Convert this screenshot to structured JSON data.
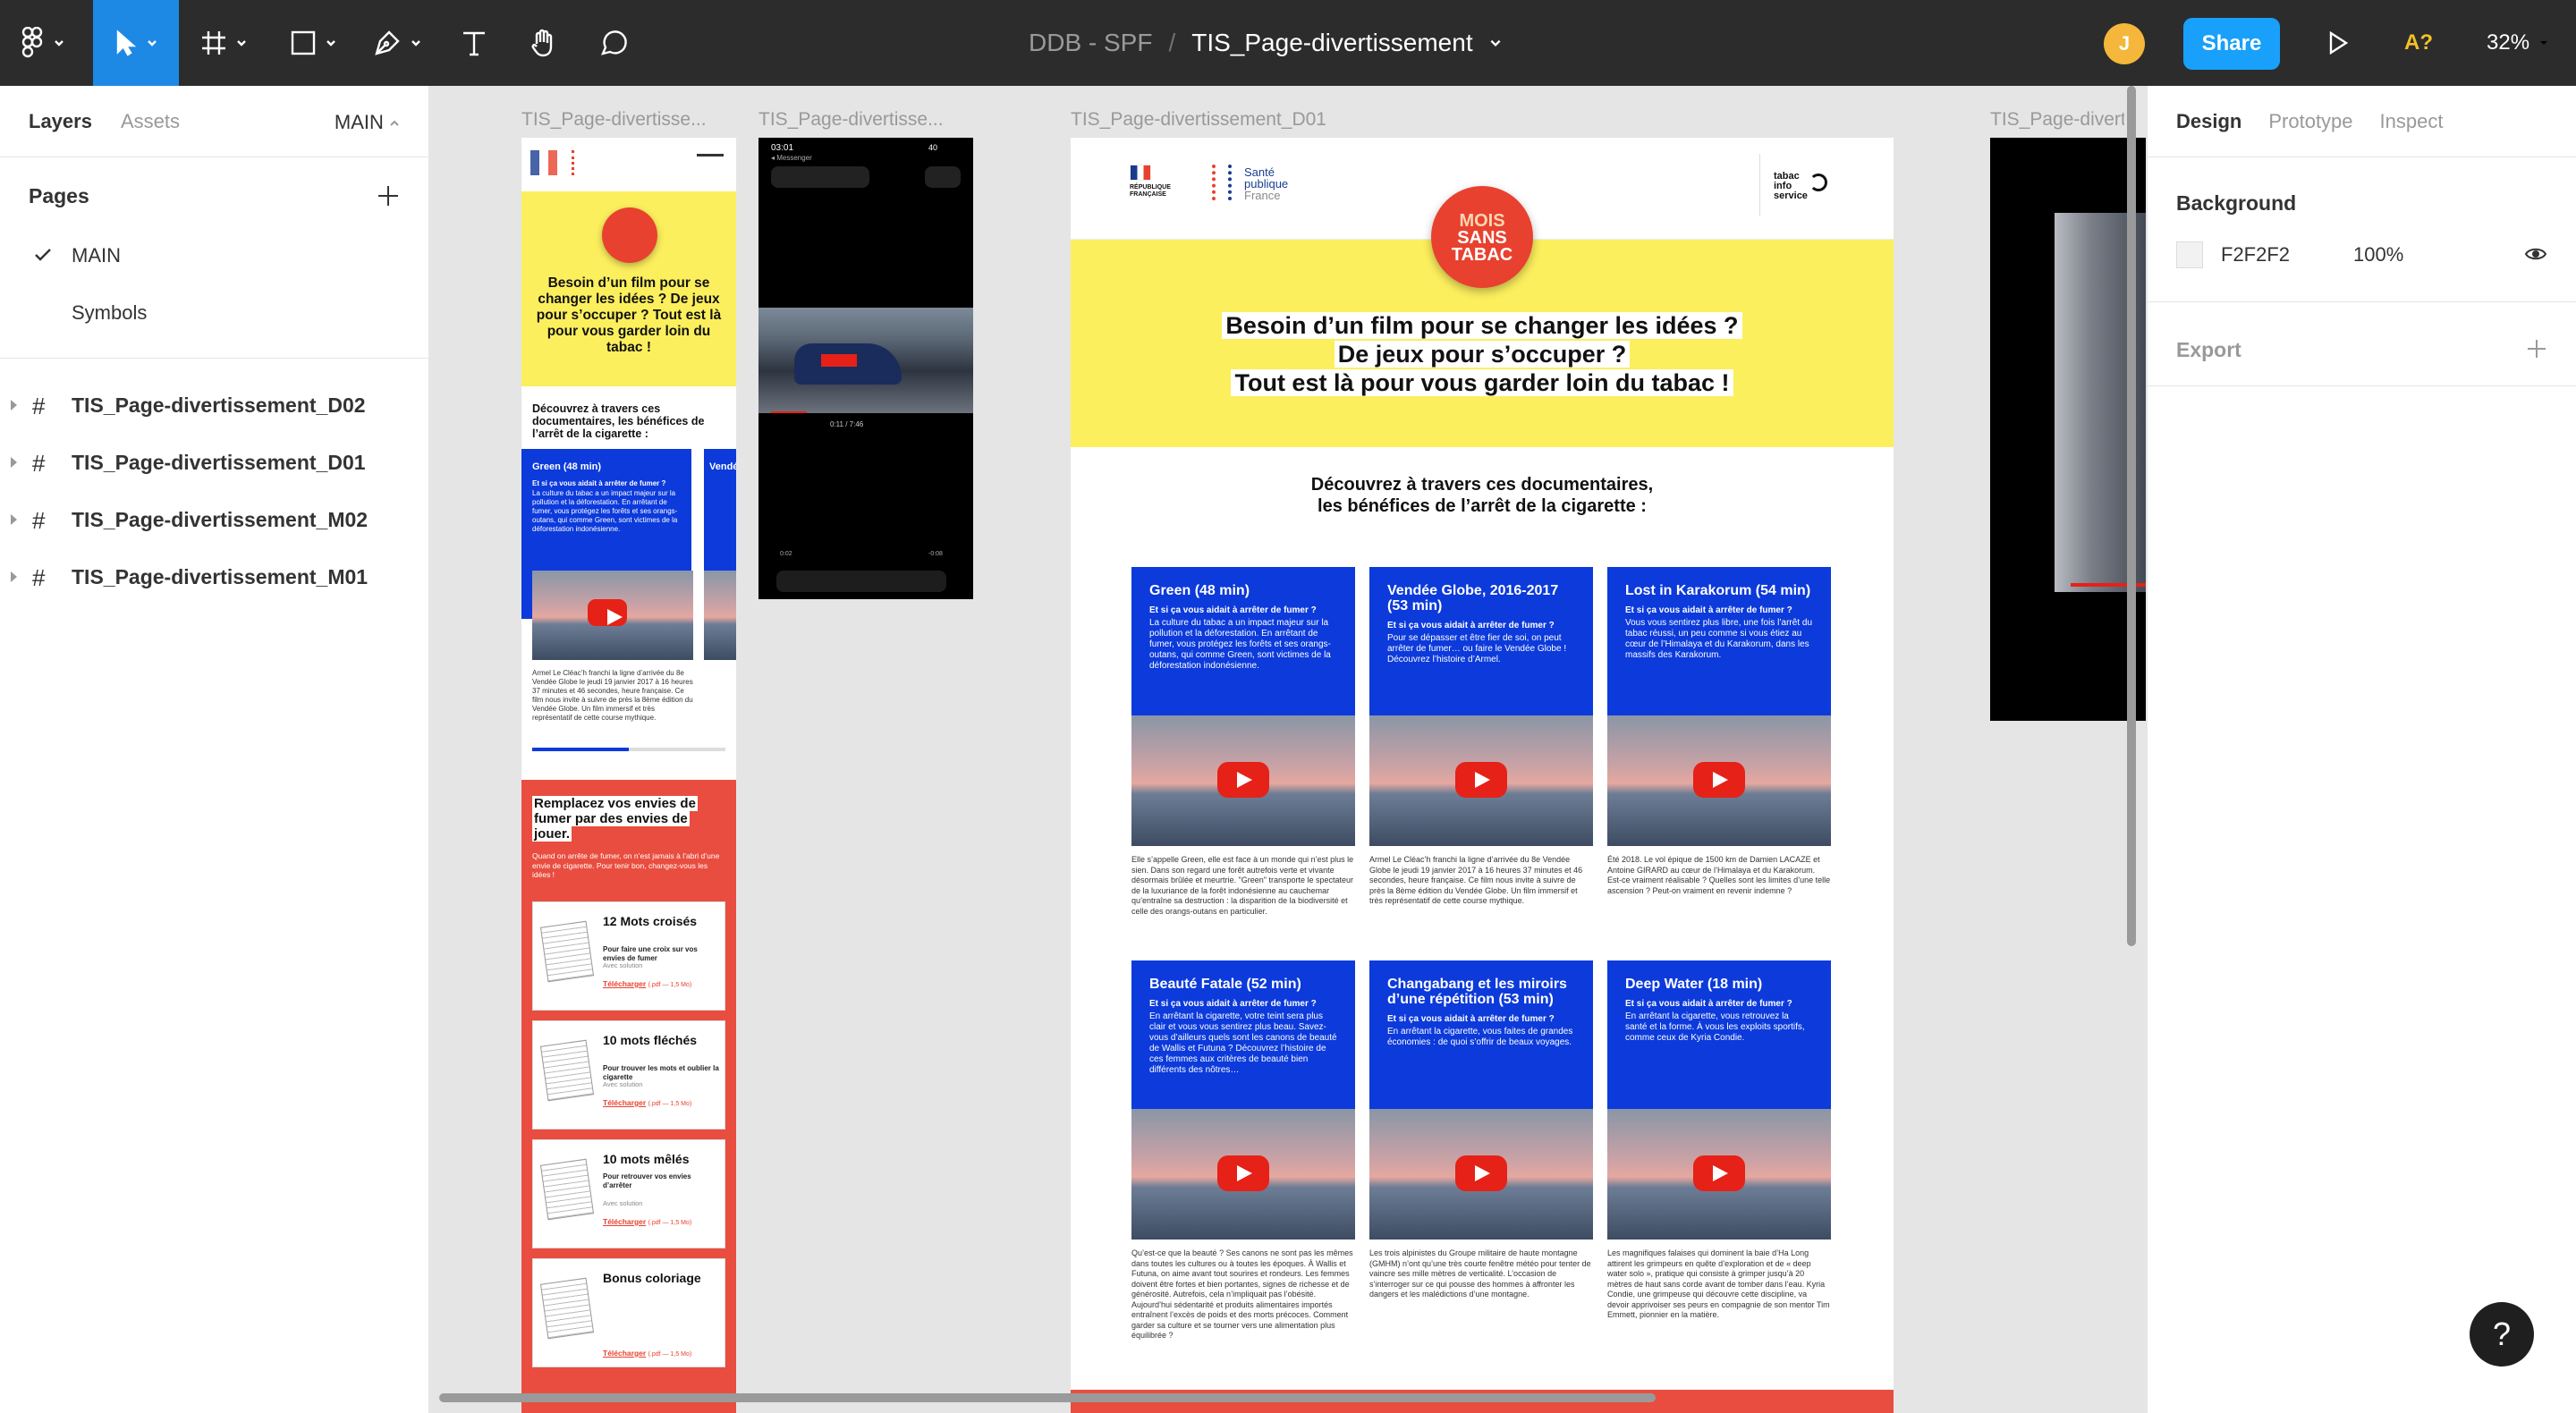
{
  "toolbar": {
    "project": "DDB - SPF",
    "file_name": "TIS_Page-divertissement",
    "avatar_initial": "J",
    "share_label": "Share",
    "a11y_label": "A?",
    "zoom": "32%"
  },
  "left_panel": {
    "tab_layers": "Layers",
    "tab_assets": "Assets",
    "page_selector": "MAIN",
    "pages_heading": "Pages",
    "pages": [
      "MAIN",
      "Symbols"
    ],
    "layers": [
      "TIS_Page-divertissement_D02",
      "TIS_Page-divertissement_D01",
      "TIS_Page-divertissement_M02",
      "TIS_Page-divertissement_M01"
    ]
  },
  "right_panel": {
    "tab_design": "Design",
    "tab_prototype": "Prototype",
    "tab_inspect": "Inspect",
    "background_heading": "Background",
    "background_hex": "F2F2F2",
    "background_opacity": "100%",
    "export_heading": "Export"
  },
  "canvas": {
    "frame_labels": [
      "TIS_Page-divertisse...",
      "TIS_Page-divertisse...",
      "TIS_Page-divertissement_D01",
      "TIS_Page-diverti"
    ],
    "desktop": {
      "logo_rf": "RÉPUBLIQUE FRANÇAISE",
      "logo_sp_line1": "Santé",
      "logo_sp_line2": "publique",
      "logo_sp_line3": "France",
      "logo_tis_line1": "tabac",
      "logo_tis_line2": "info",
      "logo_tis_line3": "service",
      "badge_line1": "MOIS",
      "badge_line2": "SANS",
      "badge_line3": "TABAC",
      "hero_line1": "Besoin d’un film pour se changer les idées ?",
      "hero_line2": "De jeux pour s’occuper ?",
      "hero_line3": "Tout est là pour vous garder loin du tabac !",
      "section_line1": "Découvrez à travers ces documentaires,",
      "section_line2": "les bénéfices de l’arrêt de la cigarette :",
      "cards": [
        {
          "title": "Green (48 min)",
          "sub": "Et si ça vous aidait à arrêter de fumer ?",
          "body": "La culture du tabac a un impact majeur sur la pollution et la déforestation. En arrêtant de fumer, vous protégez les forêts et ses orangs-outans, qui comme Green, sont victimes de la déforestation indonésienne.",
          "desc": "Elle s’appelle Green, elle est face à un monde qui n’est plus le sien. Dans son regard une forêt autrefois verte et vivante désormais brûlée et meurtrie. \"Green\" transporte le spectateur de la luxuriance de la forêt indonésienne au cauchemar qu’entraîne sa destruction : la disparition de la biodiversité et celle des orangs-outans en particulier."
        },
        {
          "title": "Vendée Globe, 2016-2017 (53 min)",
          "sub": "Et si ça vous aidait à arrêter de fumer ?",
          "body": "Pour se dépasser et être fier de soi, on peut arrêter de fumer… ou faire le Vendée Globe ! Découvrez l’histoire d’Armel.",
          "desc": "Armel Le Cléac’h franchi la ligne d’arrivée du 8e Vendée Globe le jeudi 19 janvier 2017 à 16 heures 37 minutes et 46 secondes, heure française. Ce film nous invite à suivre de près la 8ème édition du Vendée Globe. Un film immersif et très représentatif de cette course mythique."
        },
        {
          "title": "Lost in Karakorum (54 min)",
          "sub": "Et si ça vous aidait à arrêter de fumer ?",
          "body": "Vous vous sentirez plus libre, une fois l’arrêt du tabac réussi, un peu comme si vous étiez au cœur de l’Himalaya et du Karakorum, dans les massifs des Karakorum.",
          "desc": "Été 2018. Le vol épique de 1500 km de Damien LACAZE et Antoine GIRARD au cœur de l’Himalaya et du Karakorum. Est-ce vraiment réalisable ? Quelles sont les limites d’une telle ascension ? Peut-on vraiment en revenir indemne ?"
        },
        {
          "title": "Beauté Fatale (52 min)",
          "sub": "Et si ça vous aidait à arrêter de fumer ?",
          "body": "En arrêtant la cigarette, votre teint sera plus clair et vous vous sentirez plus beau. Savez-vous d’ailleurs quels sont les canons de beauté de Wallis et Futuna ? Découvrez l’histoire de ces femmes aux critères de beauté bien différents des nôtres…",
          "desc": "Qu’est-ce que la beauté ? Ses canons ne sont pas les mêmes dans toutes les cultures ou à toutes les époques. À Wallis et Futuna, on aime avant tout sourires et rondeurs. Les femmes doivent être fortes et bien portantes, signes de richesse et de générosité. Autrefois, cela n’impliquait pas l’obésité. Aujourd’hui sédentarité et produits alimentaires importés entraînent l’excès de poids et des morts précoces. Comment garder sa culture et se tourner vers une alimentation plus équilibrée ?"
        },
        {
          "title": "Changabang et les miroirs d’une répétition (53 min)",
          "sub": "Et si ça vous aidait à arrêter de fumer ?",
          "body": "En arrêtant la cigarette, vous faites de grandes économies : de quoi s’offrir de beaux voyages.",
          "desc": "Les trois alpinistes du Groupe militaire de haute montagne (GMHM) n’ont qu’une très courte fenêtre météo pour tenter de vaincre ses mille mètres de verticalité. L’occasion de s’interroger sur ce qui pousse des hommes à affronter les dangers et les malédictions d’une montagne."
        },
        {
          "title": "Deep Water (18 min)",
          "sub": "Et si ça vous aidait à arrêter de fumer ?",
          "body": "En arrêtant la cigarette, vous retrouvez la santé et la forme. À vous les exploits sportifs, comme ceux de Kyria Condie.",
          "desc": "Les magnifiques falaises qui dominent la baie d’Ha Long attirent les grimpeurs en quête d’exploration et de « deep water solo », pratique qui consiste à grimper jusqu’à 20 mètres de haut sans corde avant de tomber dans l’eau. Kyria Condie, une grimpeuse qui découvre cette discipline, va devoir apprivoiser ses peurs en compagnie de son mentor Tim Emmett, pionnier en la matière."
        }
      ]
    },
    "mobile": {
      "hero": "Besoin d’un film pour se changer les idées ? De jeux pour s’occuper ? Tout est là pour vous garder loin du tabac !",
      "section": "Découvrez à travers ces documentaires, les bénéfices de l’arrêt de la cigarette :",
      "card_title": "Green (48 min)",
      "card_title_2": "Vendé",
      "card_sub": "Et si ça vous aidait à arrêter de fumer ?",
      "card_body": "La culture du tabac a un impact majeur sur la pollution et la déforestation. En arrêtant de fumer, vous protégez les forêts et ses orangs-outans, qui comme Green, sont victimes de la déforestation indonésienne.",
      "card_desc": "Armel Le Cléac’h franchi la ligne d’arrivée du 8e Vendée Globe le jeudi 19 janvier 2017 à 16 heures 37 minutes et 46 secondes, heure française. Ce film nous invite à suivre de près la 8ème édition du Vendée Globe. Un film immersif et très représentatif de cette course mythique.",
      "progress": 0.5,
      "games_title": "Remplacez vos envies de fumer par des envies de jouer.",
      "games_intro": "Quand on arrête de fumer, on n’est jamais à l’abri d’une envie de cigarette. Pour tenir bon, changez-vous les idées !",
      "download_label": "Télécharger",
      "file_info": "(.pdf — 1,5 Mo)",
      "solution_label": "Avec solution",
      "games": [
        {
          "title": "12 Mots croisés",
          "desc": "Pour faire une croix sur vos envies de fumer",
          "solution": true
        },
        {
          "title": "10 mots fléchés",
          "desc": "Pour trouver les mots et oublier la cigarette",
          "solution": true
        },
        {
          "title": "10 mots mêlés",
          "desc": "Pour retrouver vos envies d’arrêter",
          "solution": true
        },
        {
          "title": "Bonus coloriage",
          "desc": "",
          "solution": false
        }
      ]
    },
    "phone": {
      "time": "03:01",
      "carrier": "◂ Messenger",
      "battery": "40",
      "elapsed": "0:11 / 7:46",
      "bottom_elapsed": "0:02",
      "bottom_remaining": "-0:08"
    }
  },
  "colors": {
    "toolbar": "#2c2c2c",
    "accent": "#18a0fb",
    "hero_yellow": "#fcef5d",
    "card_blue": "#0c3adb",
    "games_red": "#e94d3f",
    "badge_red": "#e8412f"
  },
  "icons": [
    "figma-menu-icon",
    "move-tool-icon",
    "frame-tool-icon",
    "shape-tool-icon",
    "pen-tool-icon",
    "text-tool-icon",
    "hand-tool-icon",
    "comment-tool-icon",
    "present-icon",
    "eye-icon",
    "plus-icon",
    "help-icon"
  ]
}
